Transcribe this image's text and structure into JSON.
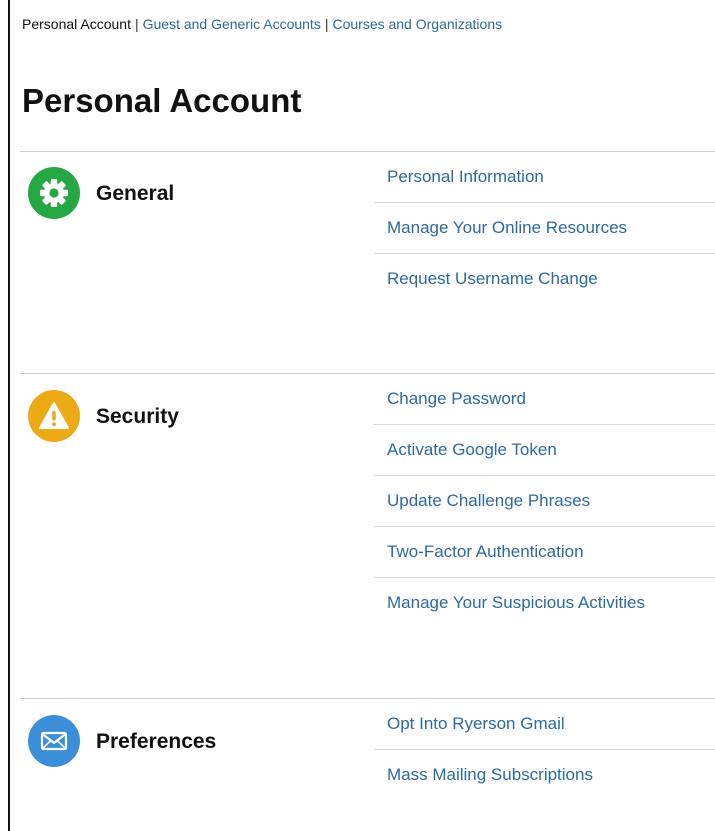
{
  "topnav": {
    "current": "Personal Account",
    "separator": "|",
    "links": [
      "Guest and Generic Accounts",
      "Courses and Organizations"
    ]
  },
  "page_title": "Personal Account",
  "sections": [
    {
      "label": "General",
      "icon": "gear-icon",
      "color": "#25a843",
      "links": [
        "Personal Information",
        "Manage Your Online Resources",
        "Request Username Change"
      ]
    },
    {
      "label": "Security",
      "icon": "warning-icon",
      "color": "#ecaa17",
      "links": [
        "Change Password",
        "Activate Google Token",
        "Update Challenge Phrases",
        "Two-Factor Authentication",
        "Manage Your Suspicious Activities"
      ]
    },
    {
      "label": "Preferences",
      "icon": "envelope-icon",
      "color": "#3b8fd8",
      "links": [
        "Opt Into Ryerson Gmail",
        "Mass Mailing Subscriptions"
      ]
    }
  ],
  "colors": {
    "link": "#2e6a9e",
    "divider": "#d6d6d6"
  }
}
